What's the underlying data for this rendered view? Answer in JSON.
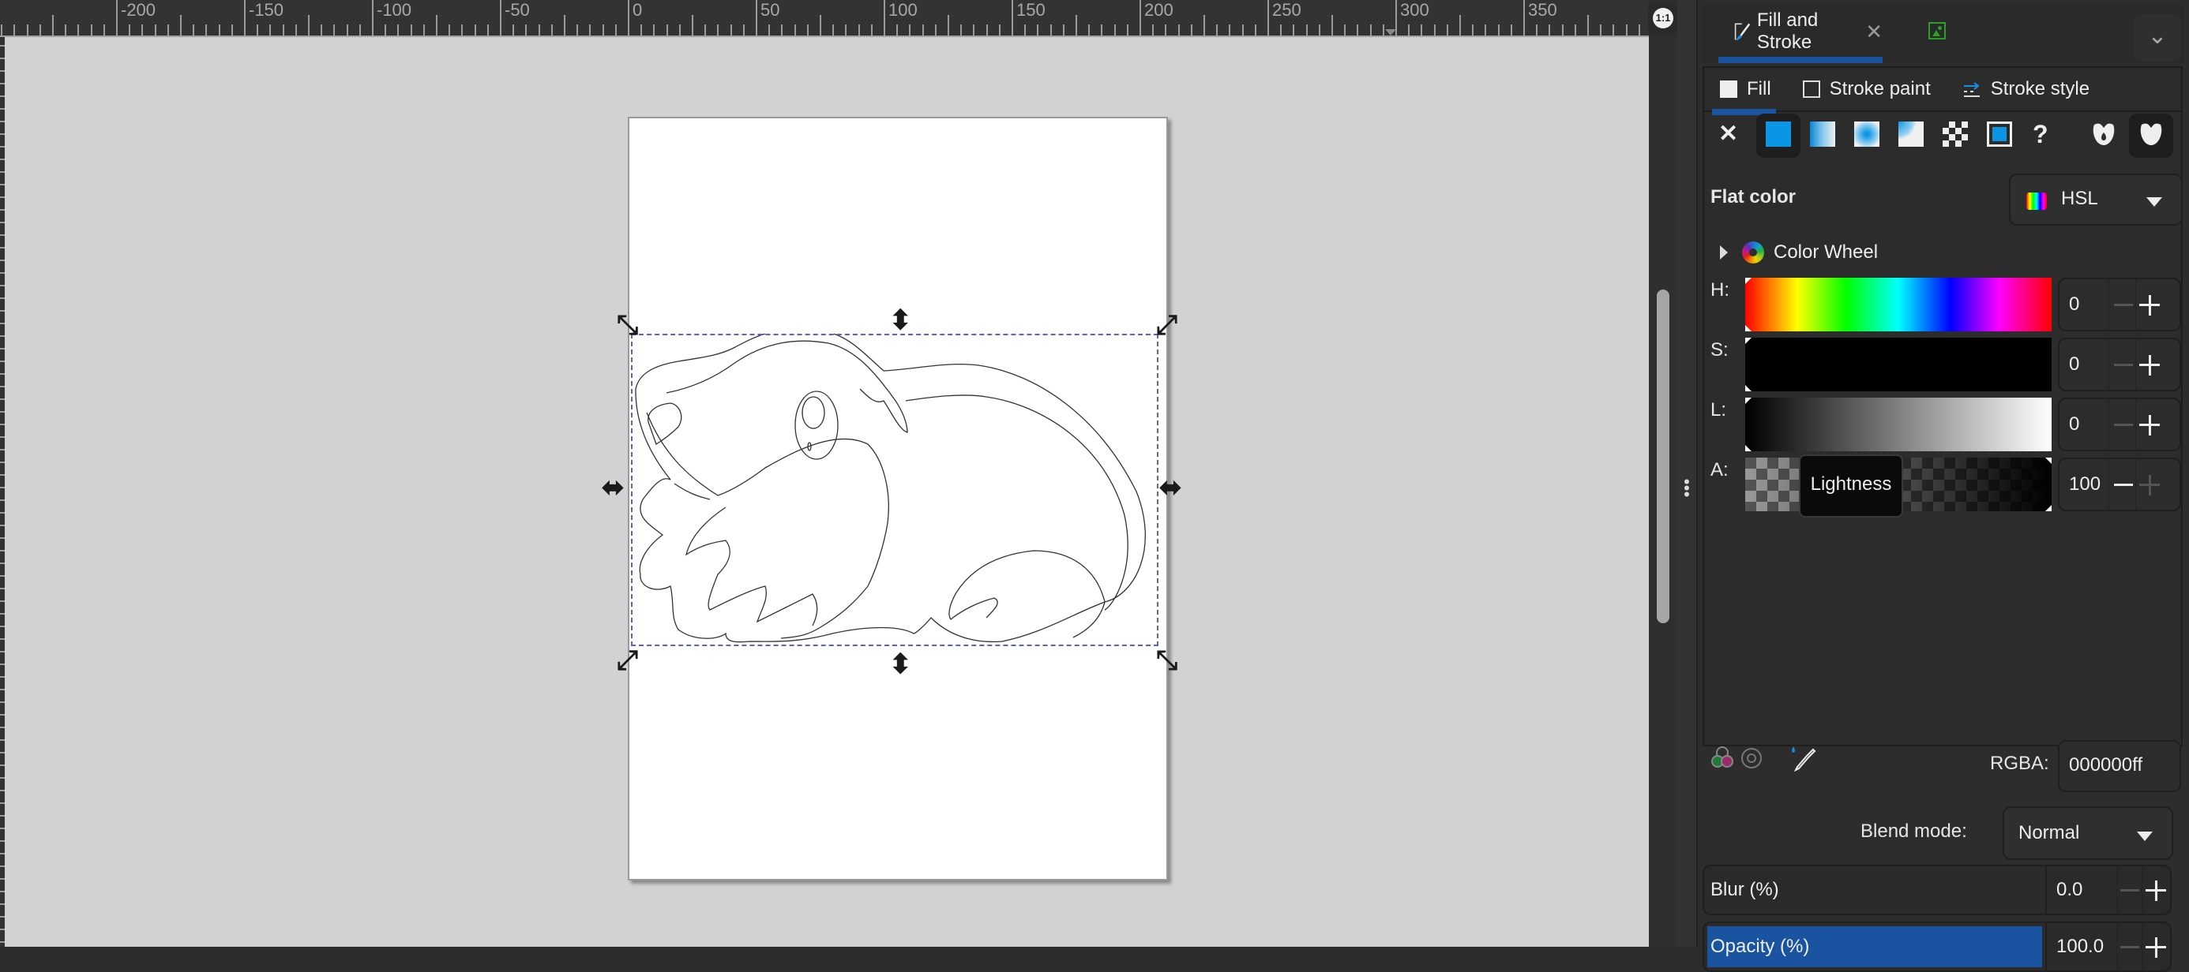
{
  "ruler": {
    "labels": [
      "-200",
      "-150",
      "-100",
      "-50",
      "0",
      "50",
      "100",
      "150",
      "200",
      "250",
      "300",
      "350"
    ]
  },
  "canvas": {
    "zoom_button_label": "1:1"
  },
  "panel": {
    "dock_tab_title": "Fill and Stroke",
    "subtabs": [
      {
        "label": "Fill",
        "active": true
      },
      {
        "label": "Stroke paint",
        "active": false
      },
      {
        "label": "Stroke style",
        "active": false
      }
    ],
    "fill_types": [
      "no-paint",
      "flat-color",
      "linear-gradient",
      "radial-gradient",
      "mesh-gradient",
      "pattern",
      "swatch",
      "unset",
      "fill-rule-evenodd",
      "fill-rule-nonzero"
    ],
    "selected_fill_type": "flat-color",
    "flat_color_label": "Flat color",
    "color_mode": "HSL",
    "color_wheel_label": "Color Wheel",
    "accent": "#1a54a0",
    "sliders": [
      {
        "label": "H:",
        "value": "0"
      },
      {
        "label": "S:",
        "value": "0"
      },
      {
        "label": "L:",
        "value": "0"
      },
      {
        "label": "A:",
        "value": "100"
      }
    ],
    "tooltip": "Lightness",
    "rgba_label": "RGBA:",
    "rgba_value": "000000ff",
    "blend_label": "Blend mode:",
    "blend_value": "Normal",
    "blur_label": "Blur (%)",
    "blur_value": "0.0",
    "opacity_label": "Opacity (%)",
    "opacity_value": "100.0"
  }
}
